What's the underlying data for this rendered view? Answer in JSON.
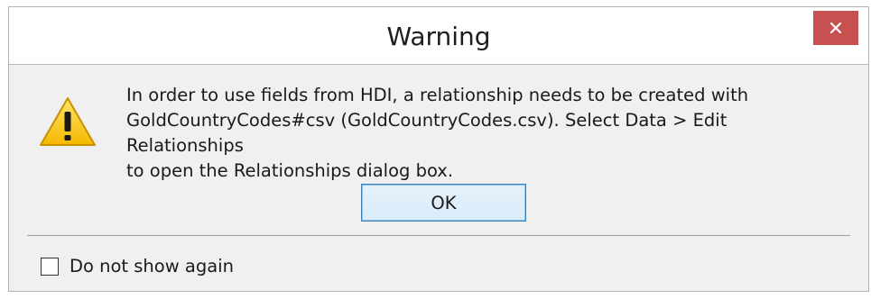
{
  "dialog": {
    "title": "Warning",
    "close_icon": "close-icon",
    "warning_icon": "warning-triangle-icon",
    "message_lines": [
      "In order to use fields from HDI, a relationship needs to be created with",
      "GoldCountryCodes#csv (GoldCountryCodes.csv). Select Data > Edit Relationships",
      "to open the Relationships dialog box."
    ],
    "ok_label": "OK",
    "checkbox": {
      "label": "Do not show again",
      "checked": false
    }
  },
  "colors": {
    "close_button": "#c75050",
    "dialog_body": "#f0f0f0",
    "ok_border": "#3c7fb1"
  }
}
